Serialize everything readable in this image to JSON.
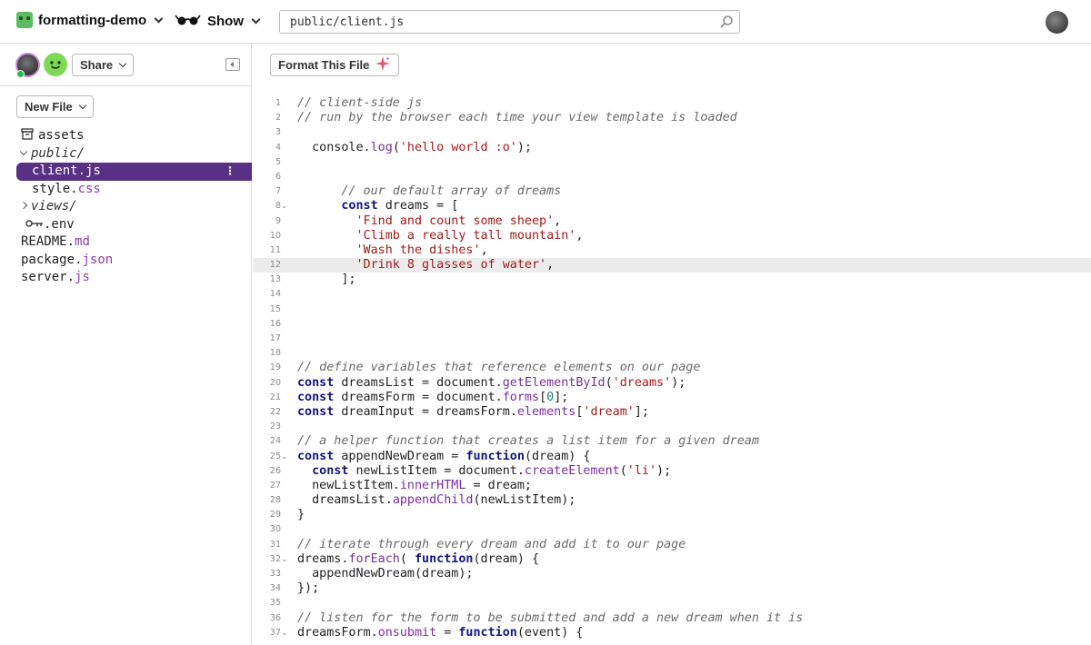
{
  "topbar": {
    "project_name": "formatting-demo",
    "show_label": "Show",
    "search_value": "public/client.js"
  },
  "sidebar": {
    "share_label": "Share",
    "new_file_label": "New File",
    "tree": [
      {
        "name": "assets",
        "ext": "",
        "type": "assets",
        "indent": 0,
        "selected": false
      },
      {
        "name": "public/",
        "ext": "",
        "type": "folder-open",
        "indent": 0,
        "selected": false
      },
      {
        "name": "client.",
        "ext": "js",
        "type": "file",
        "indent": 1,
        "selected": true
      },
      {
        "name": "style.",
        "ext": "css",
        "type": "file",
        "indent": 1,
        "selected": false
      },
      {
        "name": "views/",
        "ext": "",
        "type": "folder-closed",
        "indent": 0,
        "selected": false
      },
      {
        "name": ".env",
        "ext": "",
        "type": "env",
        "indent": 0,
        "selected": false
      },
      {
        "name": "README.",
        "ext": "md",
        "type": "file",
        "indent": 0,
        "selected": false
      },
      {
        "name": "package.",
        "ext": "json",
        "type": "file",
        "indent": 0,
        "selected": false
      },
      {
        "name": "server.",
        "ext": "js",
        "type": "file",
        "indent": 0,
        "selected": false
      }
    ]
  },
  "editor": {
    "format_label": "Format This File",
    "highlighted_line": 12,
    "lines": [
      {
        "n": "1",
        "fold": false,
        "t": [
          [
            "c",
            "// client-side js"
          ]
        ]
      },
      {
        "n": "2",
        "fold": false,
        "t": [
          [
            "c",
            "// run by the browser each time your view template is loaded"
          ]
        ]
      },
      {
        "n": "3",
        "fold": false,
        "t": []
      },
      {
        "n": "4",
        "fold": false,
        "t": [
          [
            "p",
            "  console."
          ],
          [
            "f",
            "log"
          ],
          [
            "p",
            "("
          ],
          [
            "s",
            "'hello world :o'"
          ],
          [
            "p",
            ");"
          ]
        ]
      },
      {
        "n": "5",
        "fold": false,
        "t": []
      },
      {
        "n": "6",
        "fold": false,
        "t": []
      },
      {
        "n": "7",
        "fold": false,
        "t": [
          [
            "c",
            "      // our default array of dreams"
          ]
        ]
      },
      {
        "n": "8",
        "fold": true,
        "t": [
          [
            "p",
            "      "
          ],
          [
            "k",
            "const"
          ],
          [
            "p",
            " dreams = ["
          ]
        ]
      },
      {
        "n": "9",
        "fold": false,
        "t": [
          [
            "p",
            "        "
          ],
          [
            "s",
            "'Find and count some sheep'"
          ],
          [
            "p",
            ","
          ]
        ]
      },
      {
        "n": "10",
        "fold": false,
        "t": [
          [
            "p",
            "        "
          ],
          [
            "s",
            "'Climb a really tall mountain'"
          ],
          [
            "p",
            ","
          ]
        ]
      },
      {
        "n": "11",
        "fold": false,
        "t": [
          [
            "p",
            "        "
          ],
          [
            "s",
            "'Wash the dishes'"
          ],
          [
            "p",
            ","
          ]
        ]
      },
      {
        "n": "12",
        "fold": false,
        "t": [
          [
            "p",
            "        "
          ],
          [
            "s",
            "'Drink 8 glasses of water'"
          ],
          [
            "p",
            ","
          ]
        ]
      },
      {
        "n": "13",
        "fold": false,
        "t": [
          [
            "p",
            "      ];"
          ]
        ]
      },
      {
        "n": "14",
        "fold": false,
        "t": []
      },
      {
        "n": "15",
        "fold": false,
        "t": []
      },
      {
        "n": "16",
        "fold": false,
        "t": []
      },
      {
        "n": "17",
        "fold": false,
        "t": []
      },
      {
        "n": "18",
        "fold": false,
        "t": []
      },
      {
        "n": "19",
        "fold": false,
        "t": [
          [
            "c",
            "// define variables that reference elements on our page"
          ]
        ]
      },
      {
        "n": "20",
        "fold": false,
        "t": [
          [
            "k",
            "const"
          ],
          [
            "p",
            " dreamsList = document."
          ],
          [
            "f",
            "getElementById"
          ],
          [
            "p",
            "("
          ],
          [
            "s",
            "'dreams'"
          ],
          [
            "p",
            ");"
          ]
        ]
      },
      {
        "n": "21",
        "fold": false,
        "t": [
          [
            "k",
            "const"
          ],
          [
            "p",
            " dreamsForm = document."
          ],
          [
            "f",
            "forms"
          ],
          [
            "p",
            "["
          ],
          [
            "m",
            "0"
          ],
          [
            "p",
            "];"
          ]
        ]
      },
      {
        "n": "22",
        "fold": false,
        "t": [
          [
            "k",
            "const"
          ],
          [
            "p",
            " dreamInput = dreamsForm."
          ],
          [
            "f",
            "elements"
          ],
          [
            "p",
            "["
          ],
          [
            "s",
            "'dream'"
          ],
          [
            "p",
            "];"
          ]
        ]
      },
      {
        "n": "23",
        "fold": false,
        "t": []
      },
      {
        "n": "24",
        "fold": false,
        "t": [
          [
            "c",
            "// a helper function that creates a list item for a given dream"
          ]
        ]
      },
      {
        "n": "25",
        "fold": true,
        "t": [
          [
            "k",
            "const"
          ],
          [
            "p",
            " appendNewDream = "
          ],
          [
            "k",
            "function"
          ],
          [
            "p",
            "(dream) {"
          ]
        ]
      },
      {
        "n": "26",
        "fold": false,
        "t": [
          [
            "p",
            "  "
          ],
          [
            "k",
            "const"
          ],
          [
            "p",
            " newListItem = document."
          ],
          [
            "f",
            "createElement"
          ],
          [
            "p",
            "("
          ],
          [
            "s",
            "'li'"
          ],
          [
            "p",
            ");"
          ]
        ]
      },
      {
        "n": "27",
        "fold": false,
        "t": [
          [
            "p",
            "  newListItem."
          ],
          [
            "f",
            "innerHTML"
          ],
          [
            "p",
            " = dream;"
          ]
        ]
      },
      {
        "n": "28",
        "fold": false,
        "t": [
          [
            "p",
            "  dreamsList."
          ],
          [
            "f",
            "appendChild"
          ],
          [
            "p",
            "(newListItem);"
          ]
        ]
      },
      {
        "n": "29",
        "fold": false,
        "t": [
          [
            "p",
            "}"
          ]
        ]
      },
      {
        "n": "30",
        "fold": false,
        "t": []
      },
      {
        "n": "31",
        "fold": false,
        "t": [
          [
            "c",
            "// iterate through every dream and add it to our page"
          ]
        ]
      },
      {
        "n": "32",
        "fold": true,
        "t": [
          [
            "p",
            "dreams."
          ],
          [
            "f",
            "forEach"
          ],
          [
            "p",
            "( "
          ],
          [
            "k",
            "function"
          ],
          [
            "p",
            "(dream) {"
          ]
        ]
      },
      {
        "n": "33",
        "fold": false,
        "t": [
          [
            "p",
            "  appendNewDream(dream);"
          ]
        ]
      },
      {
        "n": "34",
        "fold": false,
        "t": [
          [
            "p",
            "});"
          ]
        ]
      },
      {
        "n": "35",
        "fold": false,
        "t": []
      },
      {
        "n": "36",
        "fold": false,
        "t": [
          [
            "c",
            "// listen for the form to be submitted and add a new dream when it is"
          ]
        ]
      },
      {
        "n": "37",
        "fold": true,
        "t": [
          [
            "p",
            "dreamsForm."
          ],
          [
            "f",
            "onsubmit"
          ],
          [
            "p",
            " = "
          ],
          [
            "k",
            "function"
          ],
          [
            "p",
            "(event) {"
          ]
        ]
      }
    ]
  },
  "colors": {
    "selected_file_bg": "#583084",
    "file_extension": "#8b3fa8",
    "keyword": "#15157e",
    "string": "#a11b1b",
    "property": "#7a2e9e",
    "comment": "#6a6a6a",
    "number": "#1a7a7a",
    "online_dot": "#2eb84a"
  }
}
